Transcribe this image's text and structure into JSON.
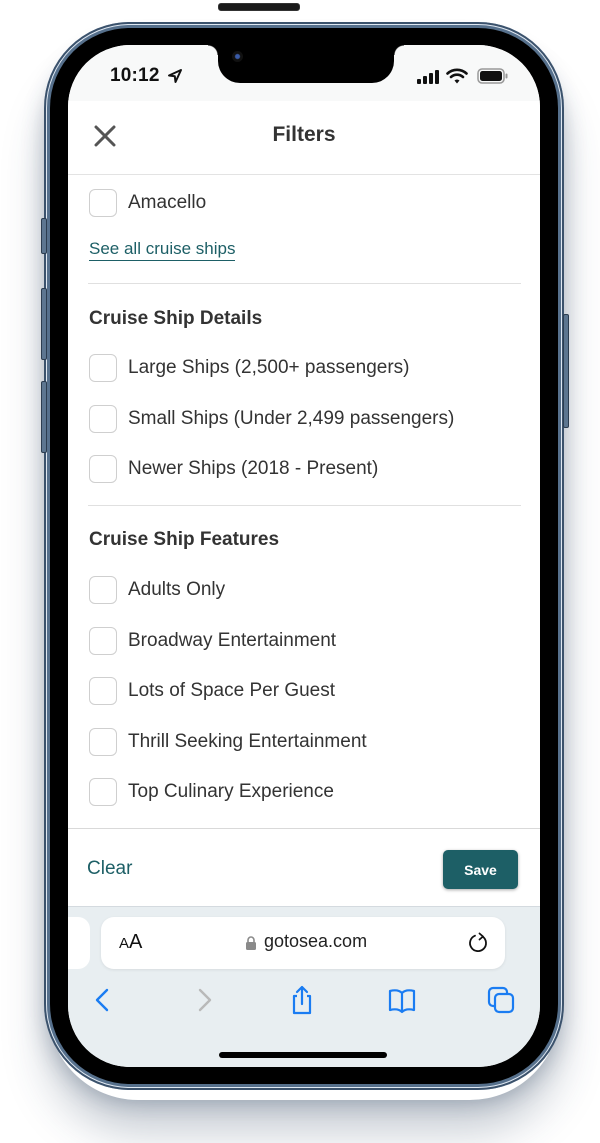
{
  "status_bar": {
    "time": "10:12",
    "icons": [
      "location-arrow-icon",
      "cellular-signal-icon",
      "wifi-icon",
      "battery-icon"
    ]
  },
  "header": {
    "title": "Filters",
    "close_icon": "close-icon"
  },
  "ships": {
    "items": [
      {
        "label": "Amacello",
        "checked": false
      }
    ],
    "see_all_label": "See all cruise ships"
  },
  "details": {
    "title": "Cruise Ship Details",
    "items": [
      {
        "label": "Large Ships (2,500+ passengers)",
        "checked": false
      },
      {
        "label": "Small Ships (Under 2,499 passengers)",
        "checked": false
      },
      {
        "label": "Newer Ships (2018 - Present)",
        "checked": false
      }
    ]
  },
  "features": {
    "title": "Cruise Ship Features",
    "items": [
      {
        "label": "Adults Only",
        "checked": false
      },
      {
        "label": "Broadway Entertainment",
        "checked": false
      },
      {
        "label": "Lots of Space Per Guest",
        "checked": false
      },
      {
        "label": "Thrill Seeking Entertainment",
        "checked": false
      },
      {
        "label": "Top Culinary Experience",
        "checked": false
      }
    ]
  },
  "footer": {
    "clear_label": "Clear",
    "save_label": "Save"
  },
  "browser": {
    "text_size_small": "A",
    "text_size_large": "A",
    "url": "gotosea.com",
    "toolbar": [
      "back-icon",
      "forward-icon",
      "share-icon",
      "bookmarks-icon",
      "tabs-icon"
    ]
  },
  "colors": {
    "accent": "#1d5f66",
    "ios_blue": "#1a7cf2",
    "text": "#333333"
  }
}
